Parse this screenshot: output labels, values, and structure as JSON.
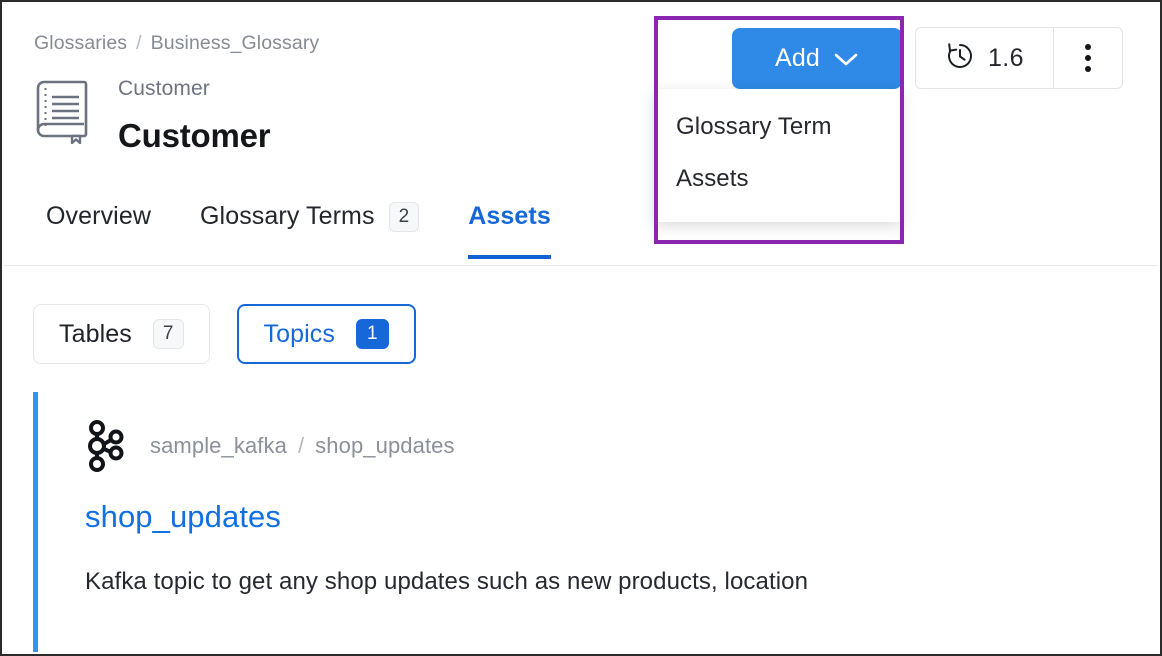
{
  "breadcrumb": {
    "items": [
      "Glossaries",
      "Business_Glossary"
    ],
    "separator": "/"
  },
  "entity": {
    "icon": "glossary-book-icon",
    "subtitle": "Customer",
    "title": "Customer"
  },
  "add": {
    "label": "Add",
    "chevron_icon": "chevron-down-icon",
    "menu_items": [
      "Glossary Term",
      "Assets"
    ]
  },
  "version": {
    "icon": "history-clock-icon",
    "value": "1.6",
    "kebab_icon": "kebab-menu-icon"
  },
  "tabs": [
    {
      "label": "Overview",
      "count": null,
      "active": false
    },
    {
      "label": "Glossary Terms",
      "count": "2",
      "active": false
    },
    {
      "label": "Assets",
      "count": null,
      "active": true
    }
  ],
  "filters": [
    {
      "label": "Tables",
      "count": "7",
      "selected": false
    },
    {
      "label": "Topics",
      "count": "1",
      "selected": true
    }
  ],
  "asset": {
    "service_icon": "kafka-icon",
    "service": "sample_kafka",
    "path_separator": "/",
    "entity": "shop_updates",
    "title": "shop_updates",
    "description": "Kafka topic to get any shop updates such as new products, location"
  },
  "colors": {
    "accent_blue": "#2e8ae6",
    "link_blue": "#1170e0",
    "active_blue": "#1668d9",
    "card_bar": "#2e96f0",
    "highlight_purple": "#8b26b3",
    "muted_text": "#8b9099"
  }
}
